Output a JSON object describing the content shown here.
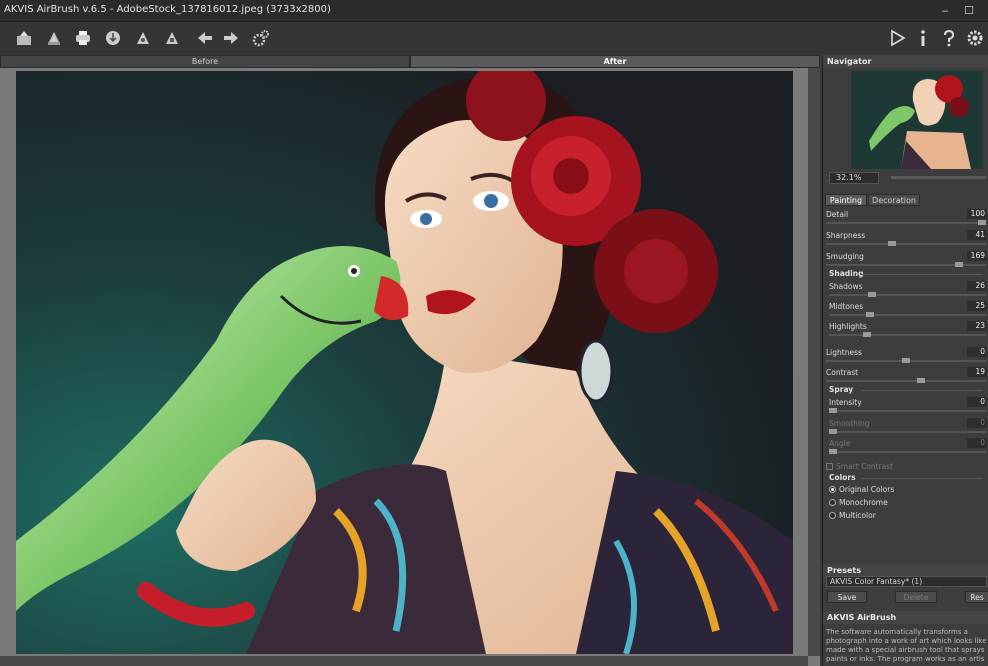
{
  "window": {
    "title": "AKVIS AirBrush v.6.5 - AdobeStock_137816012.jpeg (3733x2800)"
  },
  "toolbar": {
    "icons": [
      "open-icon",
      "save-icon",
      "print-icon",
      "share-icon",
      "batch-icon",
      "plugin-icon",
      "undo-icon",
      "redo-icon",
      "settings-gear-icon"
    ],
    "right_icons": [
      "run-icon",
      "info-icon",
      "help-icon",
      "preferences-icon"
    ]
  },
  "view_tabs": {
    "before": "Before",
    "after": "After"
  },
  "navigator": {
    "title": "Navigator",
    "zoom": "32.1%"
  },
  "panel": {
    "tabs": {
      "painting": "Painting",
      "decoration": "Decoration"
    },
    "params": [
      {
        "label": "Detail",
        "value": "100",
        "level": 1.0
      },
      {
        "label": "Sharpness",
        "value": "41",
        "level": 0.41
      },
      {
        "label": "Smudging",
        "value": "169",
        "level": 0.85
      }
    ],
    "shading": {
      "title": "Shading",
      "params": [
        {
          "label": "Shadows",
          "value": "26",
          "level": 0.26
        },
        {
          "label": "Midtones",
          "value": "25",
          "level": 0.25
        },
        {
          "label": "Highlights",
          "value": "23",
          "level": 0.23
        }
      ]
    },
    "lightness": {
      "label": "Lightness",
      "value": "0",
      "level": 0.5
    },
    "contrast": {
      "label": "Contrast",
      "value": "19",
      "level": 0.6
    },
    "spray": {
      "title": "Spray",
      "params": [
        {
          "label": "Intensity",
          "value": "0",
          "level": 0.0
        },
        {
          "label": "Smoothing",
          "value": "0",
          "level": 0.0
        },
        {
          "label": "Angle",
          "value": "0",
          "level": 0.0
        }
      ]
    },
    "smart_contrast": "Smart Contrast",
    "colors": {
      "title": "Colors",
      "options": [
        "Original Colors",
        "Monochrome",
        "Multicolor"
      ],
      "selected": "Original Colors"
    },
    "presets": {
      "title": "Presets",
      "current": "AKVIS Color Fantasy* (1)",
      "save": "Save",
      "delete": "Delete",
      "reset": "Res"
    },
    "about": {
      "title": "AKVIS AirBrush",
      "text": "The software automatically transforms a photograph into a work of art which looks like made with a special airbrush tool that sprays paints or inks. The program works as an artis"
    }
  },
  "colors": {
    "accent_red": "#b0141c",
    "parrot_green": "#7fc86a",
    "background_teal": "#1f5a55"
  }
}
